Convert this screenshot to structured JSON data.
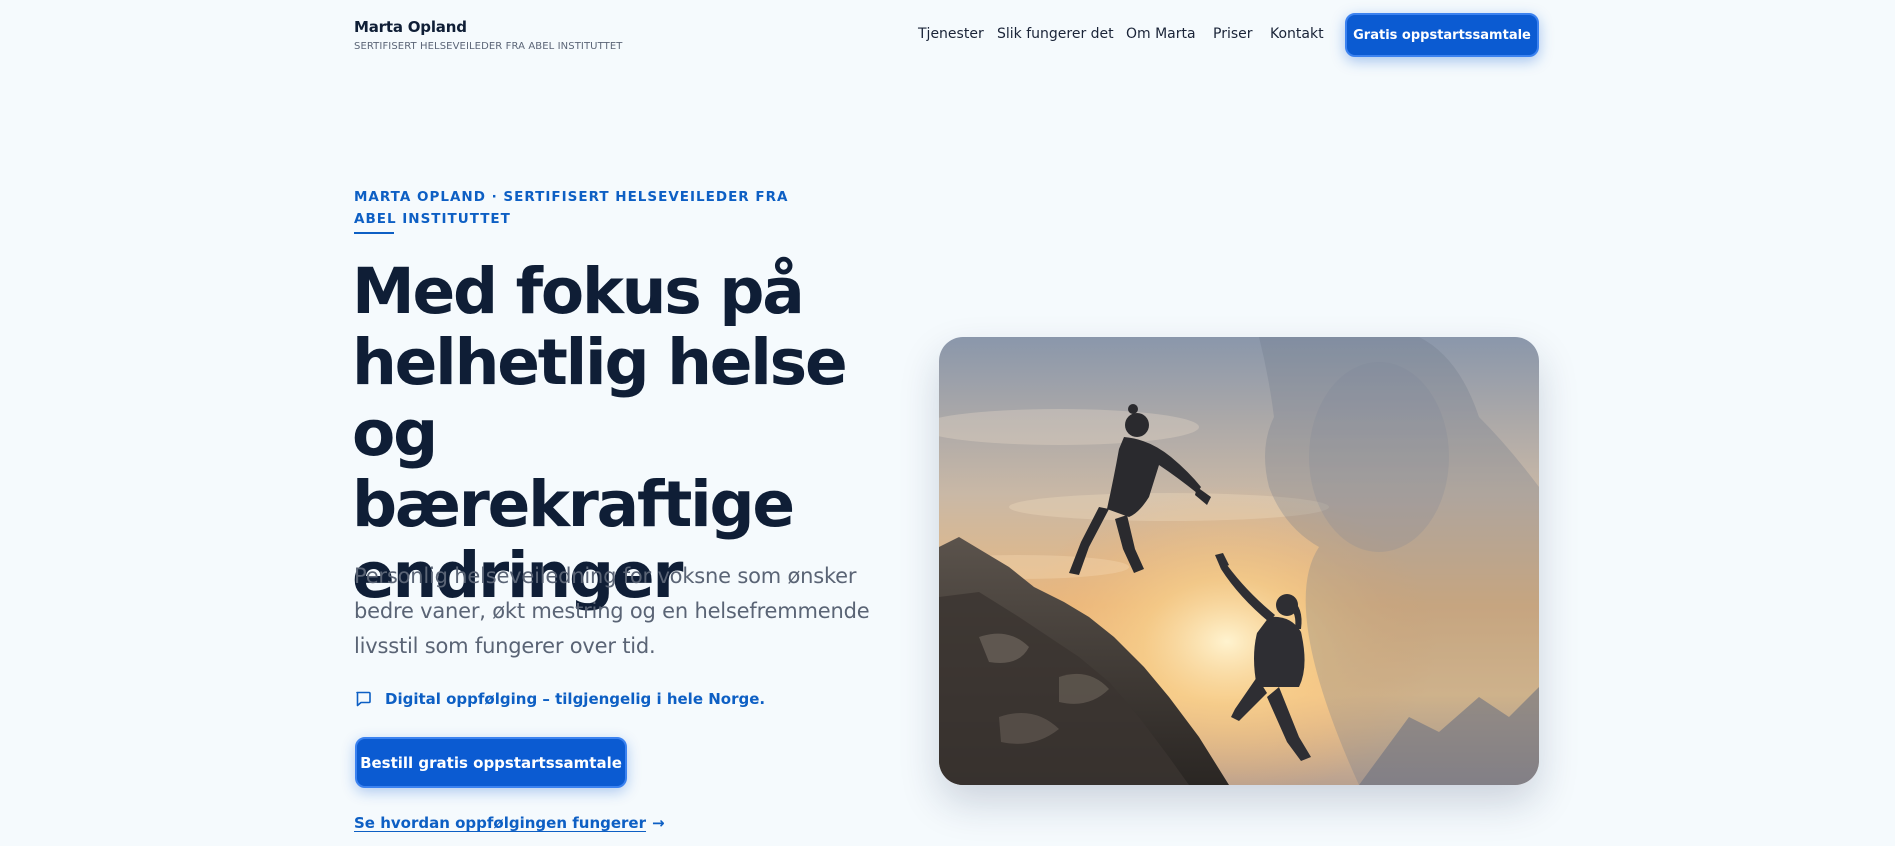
{
  "brand": {
    "name": "Marta Opland",
    "subtitle": "SERTIFISERT HELSEVEILEDER FRA ABEL INSTITUTTET"
  },
  "nav": {
    "links": [
      "Tjenester",
      "Slik fungerer det",
      "Om Marta",
      "Priser",
      "Kontakt"
    ],
    "cta_label": "Gratis oppstartssamtale"
  },
  "hero": {
    "eyebrow": "MARTA OPLAND · SERTIFISERT HELSEVEILEDER FRA ABEL INSTITUTTET",
    "headline": "Med fokus på helhetlig helse og bærekraftige endringer",
    "lead": "Personlig helseveiledning for voksne som ønsker bedre vaner, økt mestring og en helsefremmende livsstil som fungerer over tid.",
    "digital_note": "Digital oppfølging – tilgjengelig i hele Norge.",
    "cta_primary": "Bestill gratis oppstartssamtale",
    "secondary_link": "Se hvordan oppfølgingen fungerer",
    "secondary_arrow": "→"
  },
  "icons": {
    "chat": "chat-bubble-icon"
  },
  "colors": {
    "accent": "#0b5bd2",
    "accent_text": "#0d5fc4",
    "heading": "#0f1e36",
    "background": "#f5fafd"
  }
}
